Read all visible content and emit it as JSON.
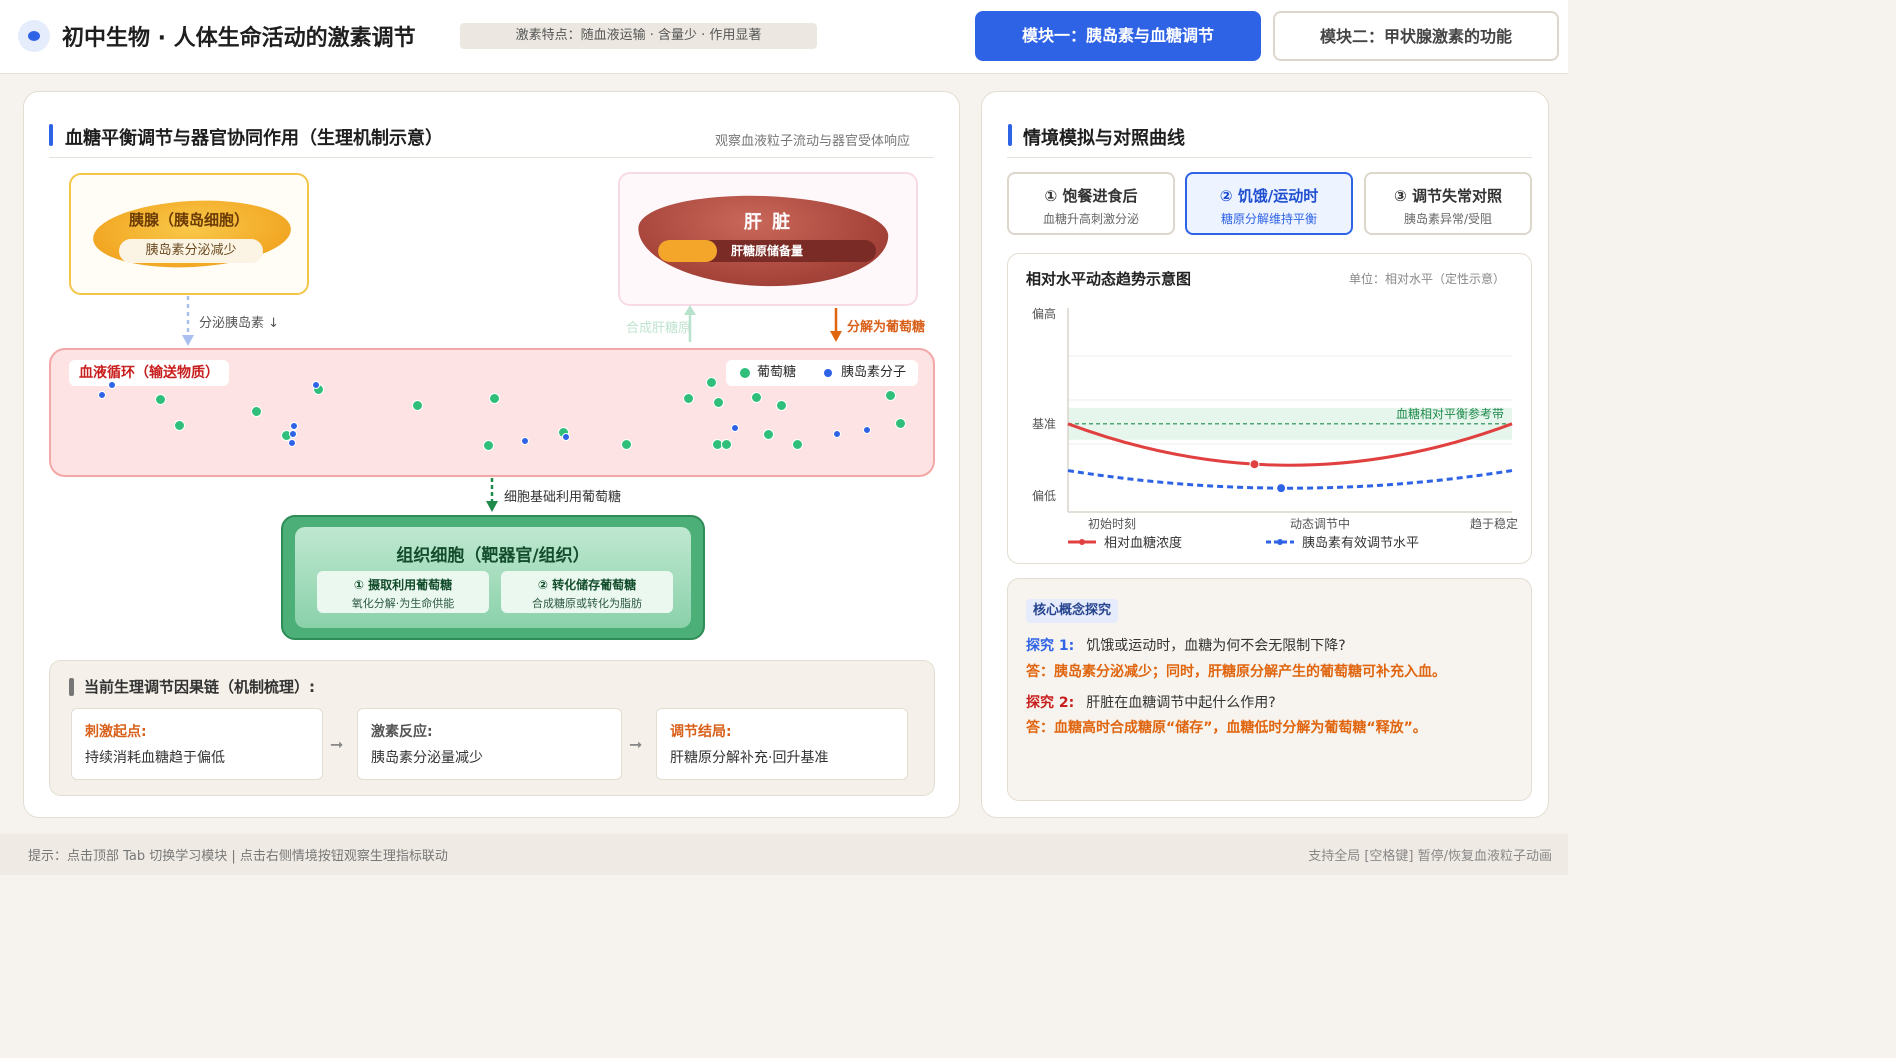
{
  "header": {
    "title": "初中生物 · 人体生命活动的激素调节",
    "feature": "激素特点：随血液运输 · 含量少 · 作用显著",
    "tabs": [
      {
        "label": "模块一：胰岛素与血糖调节",
        "active": true
      },
      {
        "label": "模块二：甲状腺激素的功能",
        "active": false
      }
    ]
  },
  "left": {
    "title": "血糖平衡调节与器官协同作用（生理机制示意）",
    "hint": "观察血液粒子流动与器官受体响应",
    "pancreas": {
      "name": "胰腺（胰岛细胞）",
      "status": "胰岛素分泌减少"
    },
    "liver": {
      "name": "肝 脏",
      "store_label": "肝糖原储备量",
      "store_level": 0.27
    },
    "arrows": {
      "secrete": "分泌胰岛素 ↓",
      "synthesize": "合成肝糖原",
      "decompose": "分解为葡萄糖",
      "cell_use": "细胞基础利用葡萄糖"
    },
    "blood": {
      "tag": "血液循环（输送物质）",
      "legend_glucose": "葡萄糖",
      "legend_insulin": "胰岛素分子"
    },
    "tissue": {
      "title": "组织细胞（靶器官/组织）",
      "cards": [
        {
          "title": "① 摄取利用葡萄糖",
          "sub": "氧化分解·为生命供能"
        },
        {
          "title": "② 转化储存葡萄糖",
          "sub": "合成糖原或转化为脂肪"
        }
      ]
    },
    "chain": {
      "title": "当前生理调节因果链（机制梳理）:",
      "steps": [
        {
          "label": "刺激起点:",
          "text": "持续消耗血糖趋于偏低",
          "color": "#d9601a"
        },
        {
          "label": "激素反应:",
          "text": "胰岛素分泌量减少",
          "color": "#555555"
        },
        {
          "label": "调节结局:",
          "text": "肝糖原分解补充·回升基准",
          "color": "#d9601a"
        }
      ]
    }
  },
  "right": {
    "title": "情境模拟与对照曲线",
    "scenarios": [
      {
        "title": "① 饱餐进食后",
        "sub": "血糖升高刺激分泌",
        "active": false
      },
      {
        "title": "② 饥饿/运动时",
        "sub": "糖原分解维持平衡",
        "active": true
      },
      {
        "title": "③ 调节失常对照",
        "sub": "胰岛素异常/受阻",
        "active": false
      }
    ],
    "concept": {
      "tag": "核心概念探究",
      "items": [
        {
          "q_label": "探究 1:",
          "q": "饥饿或运动时，血糖为何不会无限制下降?",
          "a": "答：胰岛素分泌减少；同时，肝糖原分解产生的葡萄糖可补充入血。",
          "label_color": "#2f63e6"
        },
        {
          "q_label": "探究 2:",
          "q": "肝脏在血糖调节中起什么作用?",
          "a": "答：血糖高时合成糖原“储存”，血糖低时分解为葡萄糖“释放”。",
          "label_color": "#c81e1e"
        }
      ]
    }
  },
  "chart_data": {
    "type": "line",
    "title": "相对水平动态趋势示意图",
    "unit": "单位：相对水平（定性示意）",
    "y_ticks": [
      "偏高",
      "基准",
      "偏低"
    ],
    "x_ticks": [
      "初始时刻",
      "动态调节中",
      "趋于稳定"
    ],
    "x": [
      0,
      0.5,
      1
    ],
    "reference_band_label": "血糖相对平衡参考带",
    "reference_level": 0,
    "ylim": [
      -1,
      1.2
    ],
    "series": [
      {
        "name": "相对血糖浓度",
        "color": "#e0403f",
        "dashed": false,
        "values": [
          0,
          -0.47,
          0
        ]
      },
      {
        "name": "胰岛素有效调节水平",
        "color": "#2f63e6",
        "dashed": true,
        "values": [
          -0.53,
          -0.73,
          -0.53
        ]
      }
    ],
    "markers": [
      {
        "series": 0,
        "x": 0.42
      },
      {
        "series": 1,
        "x": 0.48
      }
    ],
    "grid": true,
    "legend": "bottom"
  },
  "footer": {
    "left": "提示：点击顶部 Tab 切换学习模块 | 点击右侧情境按钮观察生理指标联动",
    "right": "支持全局 [空格键] 暂停/恢复血液粒子动画"
  }
}
